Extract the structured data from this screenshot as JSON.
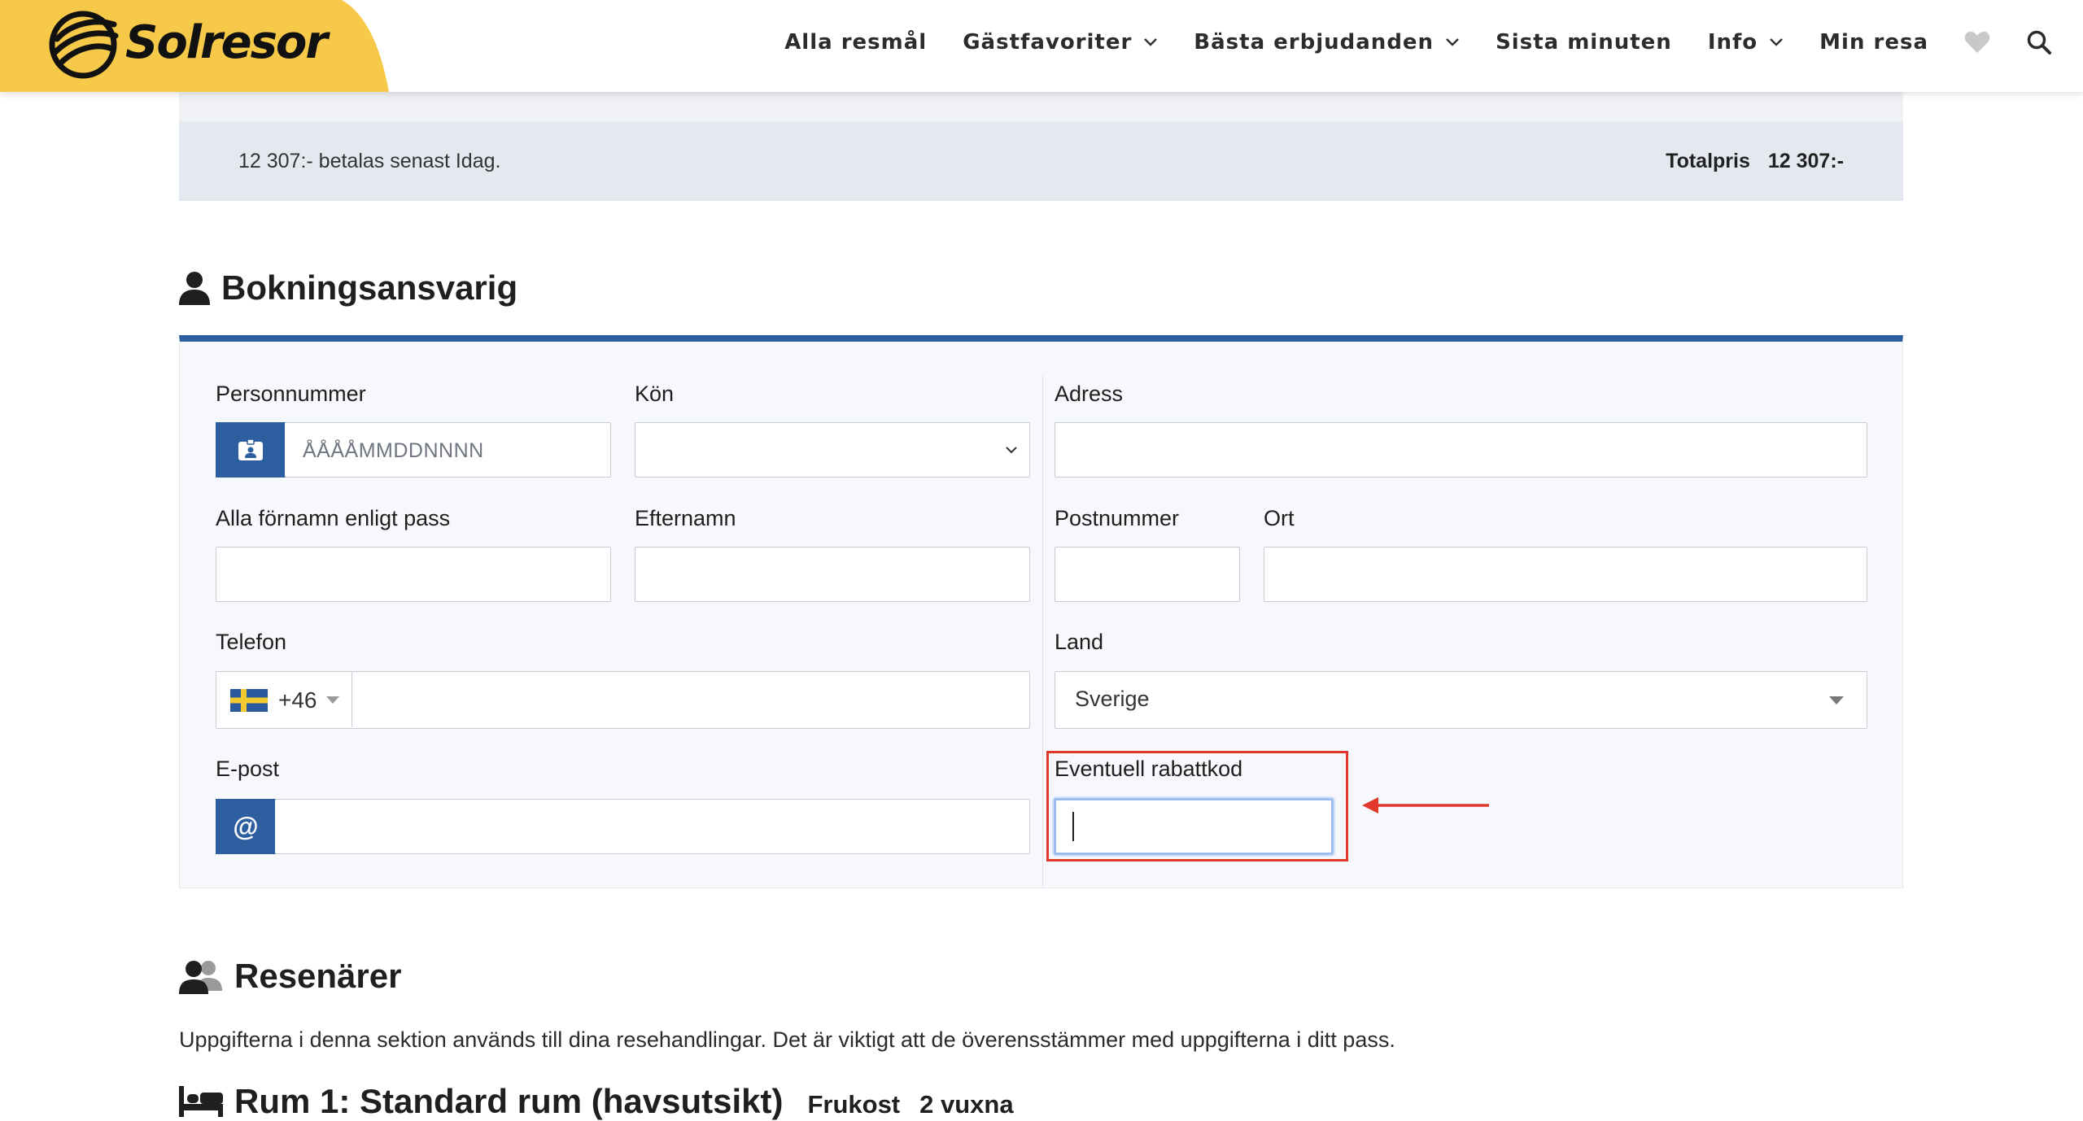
{
  "header": {
    "logo_text": "Solresor",
    "nav": [
      {
        "label": "Alla resmål",
        "dropdown": false
      },
      {
        "label": "Gästfavoriter",
        "dropdown": true
      },
      {
        "label": "Bästa erbjudanden",
        "dropdown": true
      },
      {
        "label": "Sista minuten",
        "dropdown": false
      },
      {
        "label": "Info",
        "dropdown": true
      },
      {
        "label": "Min resa",
        "dropdown": false
      }
    ],
    "icons": [
      "heart-icon",
      "search-icon"
    ],
    "brand_color": "#f7c948"
  },
  "summary": {
    "due_text": "12 307:- betalas senast Idag.",
    "total_label": "Totalpris",
    "total_value": "12 307:-"
  },
  "booker": {
    "heading": "Bokningsansvarig",
    "fields": {
      "personnummer": {
        "label": "Personnummer",
        "placeholder": "ÅÅÅÅMMDDNNNN",
        "value": ""
      },
      "kon": {
        "label": "Kön",
        "value": ""
      },
      "adress": {
        "label": "Adress",
        "value": ""
      },
      "fornamn": {
        "label": "Alla förnamn enligt pass",
        "value": ""
      },
      "efternamn": {
        "label": "Efternamn",
        "value": ""
      },
      "postnummer": {
        "label": "Postnummer",
        "value": ""
      },
      "ort": {
        "label": "Ort",
        "value": ""
      },
      "telefon": {
        "label": "Telefon",
        "country_code": "+46",
        "value": ""
      },
      "land": {
        "label": "Land",
        "value": "Sverige"
      },
      "epost": {
        "label": "E-post",
        "addon": "@",
        "value": ""
      },
      "rabattkod": {
        "label": "Eventuell rabattkod",
        "value": ""
      }
    }
  },
  "travelers": {
    "heading": "Resenärer",
    "intro": "Uppgifterna i denna sektion används till dina resehandlingar. Det är viktigt att de överensstämmer med uppgifterna i ditt pass.",
    "room_title": "Rum 1: Standard rum (havsutsikt)",
    "room_board": "Frukost",
    "room_guests": "2 vuxna"
  },
  "colors": {
    "accent_blue": "#2d5fa0",
    "highlight_red": "#e0392b"
  }
}
